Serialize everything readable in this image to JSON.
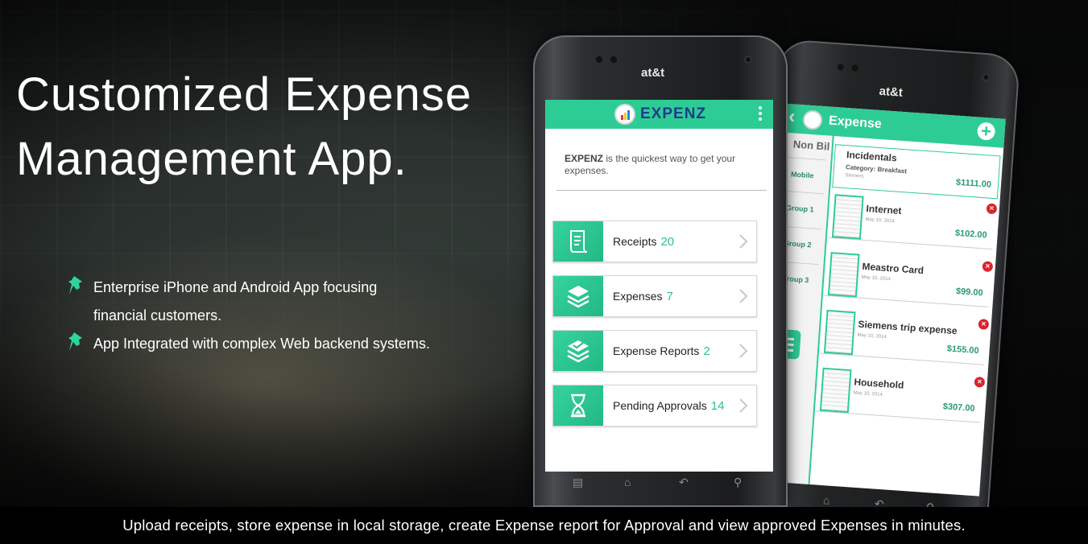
{
  "headline": {
    "line1": "Customized Expense",
    "line2": "Management App."
  },
  "bullets": [
    {
      "line1": "Enterprise iPhone and Android App focusing",
      "line2": "financial customers."
    },
    {
      "line1": "App Integrated with complex Web backend systems."
    }
  ],
  "footer": "Upload receipts, store expense in local storage, create Expense report for Approval and view approved Expenses in minutes.",
  "phone1": {
    "carrier": "at&t",
    "app_name": "EXPENZ",
    "intro_bold": "EXPENZ",
    "intro_text": " is the quickest way to get your expenses.",
    "menu": [
      {
        "label": "Receipts",
        "count": "20",
        "icon": "receipt-icon"
      },
      {
        "label": "Expenses",
        "count": "7",
        "icon": "layers-icon"
      },
      {
        "label": "Expense Reports",
        "count": "2",
        "icon": "report-layers-icon"
      },
      {
        "label": "Pending Approvals",
        "count": "14",
        "icon": "hourglass-icon"
      }
    ]
  },
  "phone2": {
    "carrier": "at&t",
    "title": "Expense",
    "sidebar_header": "Non Bil",
    "sidebar_items": [
      "Mobile",
      "Group 1",
      "Group 2",
      "Group 3"
    ],
    "cards": [
      {
        "name": "Incidentals",
        "sub": "Category: Breakfast",
        "sub2": "Siemens",
        "amount": "$1111.00"
      },
      {
        "name": "Internet",
        "date": "May 10, 2014",
        "amount": "$102.00"
      },
      {
        "name": "Meastro Card",
        "date": "May 10, 2014",
        "amount": "$99.00"
      },
      {
        "name": "Siemens trip expense",
        "date": "May 10, 2014",
        "amount": "$155.00"
      },
      {
        "name": "Household",
        "date": "May 10, 2014",
        "amount": "$307.00"
      }
    ]
  },
  "colors": {
    "accent": "#2ecc95",
    "brand_text": "#1e3c8c",
    "delete": "#d9242a"
  }
}
